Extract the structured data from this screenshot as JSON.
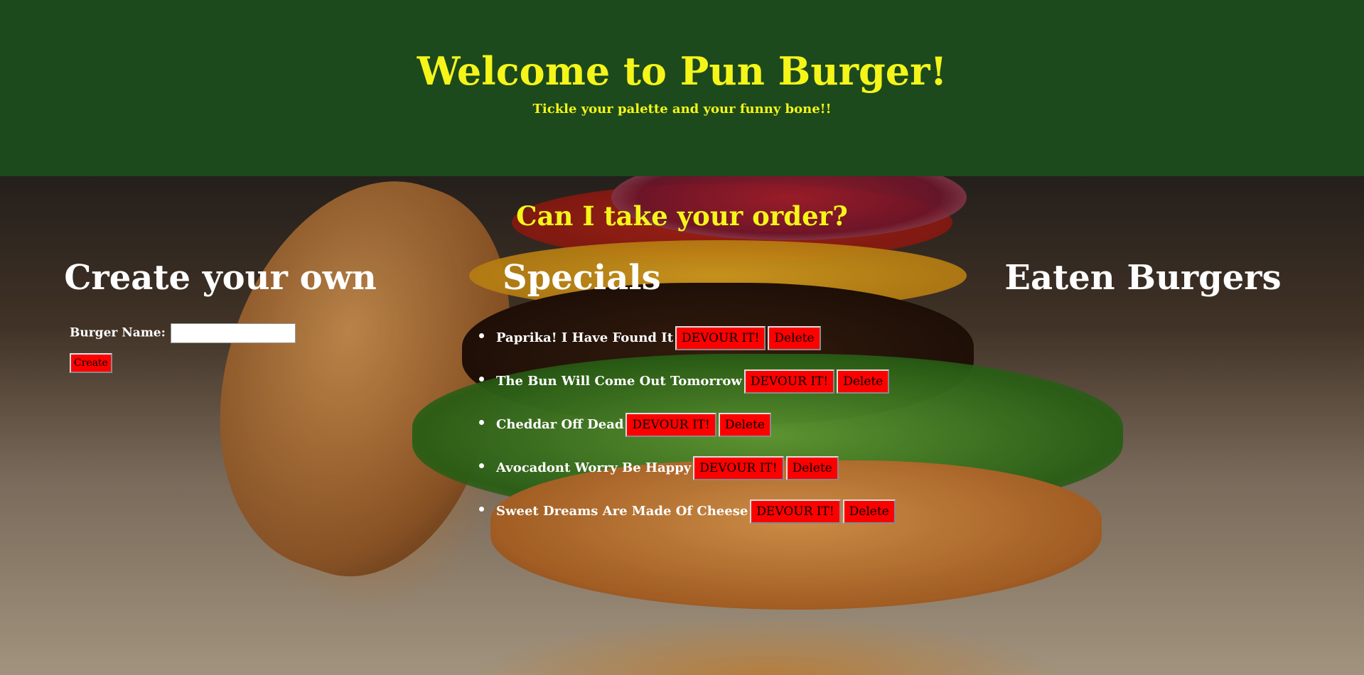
{
  "header": {
    "title": "Welcome to Pun Burger!",
    "tagline": "Tickle your palette and your funny bone!!",
    "background_color": "#1c4a1c",
    "text_color": "#f5f51a"
  },
  "main": {
    "order_title": "Can I take your order?",
    "columns": {
      "create": {
        "title": "Create your own",
        "burger_name_label": "Burger Name:",
        "burger_name_value": "",
        "create_button": "Create"
      },
      "specials": {
        "title": "Specials",
        "devour_label": "DEVOUR IT!",
        "delete_label": "Delete",
        "items": [
          {
            "name": "Paprika! I Have Found It"
          },
          {
            "name": "The Bun Will Come Out Tomorrow"
          },
          {
            "name": "Cheddar Off Dead"
          },
          {
            "name": "Avocadont Worry Be Happy"
          },
          {
            "name": "Sweet Dreams Are Made Of Cheese"
          }
        ]
      },
      "eaten": {
        "title": "Eaten Burgers",
        "items": []
      }
    },
    "button_color": "#ff0000"
  }
}
